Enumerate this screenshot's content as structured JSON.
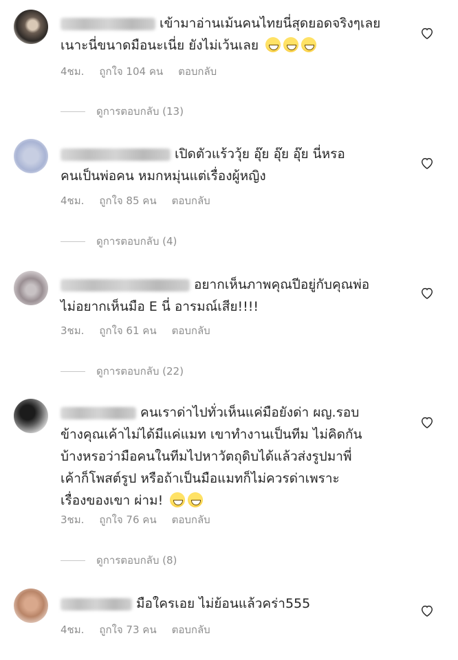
{
  "comments": [
    {
      "text_lines": [
        "เข้ามาอ่านเม้นคนไทยนี่สุดยอดจริงๆเลย",
        "เนาะนี่ขนาดมือนะเนี่ย ยังไม่เว้นเลย"
      ],
      "emoji_count": 3,
      "time": "4ชม.",
      "likes": "ถูกใจ 104 คน",
      "reply": "ตอบกลับ",
      "view_replies": "ดูการตอบกลับ (13)"
    },
    {
      "text_lines": [
        "เปิดตัวแร้ววุ้ย อุ๊ย อุ๊ย อุ๊ย นี่หรอ",
        "คนเป็นพ่อคน หมกหมุ่นแต่เรื่องผู้หญิง"
      ],
      "emoji_count": 0,
      "time": "4ชม.",
      "likes": "ถูกใจ 85 คน",
      "reply": "ตอบกลับ",
      "view_replies": "ดูการตอบกลับ (4)"
    },
    {
      "text_lines": [
        "อยากเห็นภาพคุณปีอยู่กับคุณพ่อ",
        "ไม่อยากเห็นมือ E นี่ อารมณ์เสีย!!!!"
      ],
      "emoji_count": 0,
      "time": "3ชม.",
      "likes": "ถูกใจ 61 คน",
      "reply": "ตอบกลับ",
      "view_replies": "ดูการตอบกลับ (22)"
    },
    {
      "text_lines": [
        "คนเราด่าไปทั่วเห็นแค่มือยังด่า ผญ.รอบ",
        "ข้างคุณเค้าไม่ได้มีแค่แมท เขาทำงานเป็นทีม ไม่คิดกัน",
        "บ้างหรอว่ามือคนในทีมไปหาวัตถุดิบได้แล้วส่งรูปมาพี่",
        "เค้าก็โพสต์รูป หรือถ้าเป็นมือแมทก็ไม่ควรด่าเพราะ",
        "เรื่องของเขา ผ่าม!"
      ],
      "emoji_count": 2,
      "time": "3ชม.",
      "likes": "ถูกใจ 76 คน",
      "reply": "ตอบกลับ",
      "view_replies": "ดูการตอบกลับ (8)"
    },
    {
      "text_lines": [
        "มือใครเอย ไม่ย้อนแล้วคร่า555"
      ],
      "emoji_count": 0,
      "time": "4ชม.",
      "likes": "ถูกใจ 73 คน",
      "reply": "ตอบกลับ"
    }
  ],
  "icons": {
    "like": "heart-outline-icon",
    "emoji": "grinning-face-icon"
  },
  "colors": {
    "text": "#262626",
    "muted": "#8e8e8e",
    "divider": "#c7c7c7"
  }
}
